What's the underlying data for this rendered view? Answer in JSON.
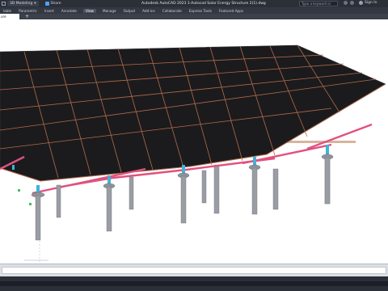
{
  "titlebar": {
    "workspace": "3D Modeling",
    "share_label": "Share",
    "title": "Autodesk AutoCAD 2023    1-Autocad Solar Energy Structure 2(1).dwg",
    "search_placeholder": "Type a keyword or phrase",
    "signin_label": "Sign In"
  },
  "ribbon": {
    "tabs": [
      {
        "label": "lable"
      },
      {
        "label": "Parametric"
      },
      {
        "label": "Insert"
      },
      {
        "label": "Annotate"
      },
      {
        "label": "View",
        "active": true
      },
      {
        "label": "Manage"
      },
      {
        "label": "Output"
      },
      {
        "label": "Add-ins"
      },
      {
        "label": "Collaborate"
      },
      {
        "label": "Express Tools"
      },
      {
        "label": "Featured Apps"
      }
    ]
  },
  "doc_tabs": {
    "current": "ure 2x(1)*",
    "close_glyph": "×",
    "new_tab_glyph": "+"
  },
  "colors": {
    "panel": "#1b1b1d",
    "panel_grid": "#b46a4c",
    "pink_rail": "#e0517e",
    "cyan_clamp": "#3fb4d6",
    "post": "#9a9da3"
  }
}
